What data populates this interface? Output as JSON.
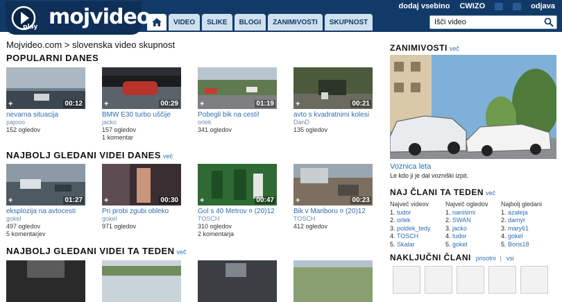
{
  "header": {
    "logo_text": "mojvideo",
    "logo_badge": "play",
    "top_links": [
      "dodaj vsebino",
      "CWIZO",
      "odjava"
    ],
    "nav_tabs": [
      "VIDEO",
      "SLIKE",
      "BLOGI",
      "ZANIMIVOSTI",
      "SKUPNOST"
    ],
    "search_value": "Išči video"
  },
  "breadcrumb": "Mojvideo.com > slovenska video skupnost",
  "sections": [
    {
      "title": "POPULARNI DANES",
      "more": "",
      "videos": [
        {
          "title": "nevarna situacija",
          "user": "pajooo",
          "duration": "00:12",
          "meta": [
            "152 ogledov"
          ]
        },
        {
          "title": "BMW E30 turbo uščije",
          "user": "jacko",
          "duration": "00:29",
          "meta": [
            "157 ogledov",
            "1 komentar"
          ]
        },
        {
          "title": "Pobegli bik na cesti!",
          "user": "orlek",
          "duration": "01:19",
          "meta": [
            "341 ogledov"
          ]
        },
        {
          "title": "avto s kvadratnimi kolesi",
          "user": "DanD",
          "duration": "00:21",
          "meta": [
            "135 ogledov"
          ]
        }
      ]
    },
    {
      "title": "NAJBOLJ GLEDANI VIDEI DANES",
      "more": "več",
      "videos": [
        {
          "title": "eksplozija na avtocesti",
          "user": "gokel",
          "duration": "01:27",
          "meta": [
            "497 ogledov",
            "5 komentarjev"
          ]
        },
        {
          "title": "Pri probi zgubi obleko",
          "user": "gokel",
          "duration": "00:30",
          "meta": [
            "971 ogledov"
          ]
        },
        {
          "title": "Gol s 40 Metrov ¤ (20)12",
          "user": "TOSCH",
          "duration": "00:47",
          "meta": [
            "310 ogledov",
            "2 komentarja"
          ]
        },
        {
          "title": "Bik v Mariboru ¤ (20)12",
          "user": "TOSCH",
          "duration": "00:23",
          "meta": [
            "412 ogledov"
          ]
        }
      ]
    },
    {
      "title": "NAJBOLJ GLEDANI VIDEI TA TEDEN",
      "more": "več",
      "videos": []
    }
  ],
  "right": {
    "zanimivosti_title": "ZANIMIVOSTI",
    "zanimivosti_more": "več",
    "featured_title": "Voznica leta",
    "featured_desc": "Le kdo ji je dal vozniški izpit.",
    "clani_title": "NAJ ČLANI TA TEDEN",
    "clani_more": "več",
    "columns": [
      {
        "header": "Največ videov",
        "items": [
          "tudor",
          "orlek",
          "poldek_tedy",
          "TOSCH",
          "Skalar"
        ]
      },
      {
        "header": "Največ ogledov",
        "items": [
          "nanisimi",
          "SWAN",
          "jacko",
          "tudor",
          "gokel"
        ]
      },
      {
        "header": "Najbolj gledani",
        "items": [
          "azaleja",
          "damyr",
          "mary61",
          "gokel",
          "Boris18"
        ]
      }
    ],
    "random_title": "NAKLJUČNI ČLANI",
    "random_links": [
      "prisotni",
      "vsi"
    ]
  },
  "colors": {
    "header_bg": "#123a68",
    "link": "#2e6db3",
    "tab_bg": "#cfe0ef"
  }
}
